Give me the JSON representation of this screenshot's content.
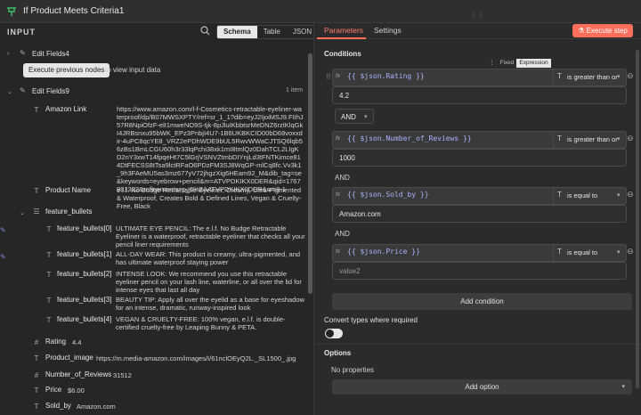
{
  "window": {
    "title": "If Product Meets Criteria1"
  },
  "input_panel": {
    "label": "INPUT",
    "view_tabs": [
      "Schema",
      "Table",
      "JSON"
    ],
    "nodes": [
      {
        "name": "Edit Fields4",
        "action_button": "Execute previous nodes",
        "action_hint": "to view input data"
      },
      {
        "name": "Edit Fields9",
        "count": "1 item"
      }
    ],
    "fields": {
      "amazon_link": {
        "key": "Amazon Link",
        "value": "https://www.amazon.com/l-f-Cosmetics-retractable-eyeliner-waterproof/dp/B07MWSXPTY/ref=sr_1_1?dib=eyJ2IjoiMSJ9.FIIhJ57R8NpiOfzF-elI1mweNO9S-tjk-8pJluIKbbtsrMeDNZ6rzIKlqGkI4JRBsnxu95bWK_EPz3PnbjI4U7-1B6UKBKCID00bD68voxxdir-4uPC8qcYE8_VRZ2ePDhWDE9bUL5RwvWWaCJTSQ6lqb56zBs1BmLCGU60h3r33lqPchi38xk1mI8tmlQz0DahTCL2LIgKD2nY3xwT14fpqeHt7C5lGrjVSNVZtmbDIYnjLd3tFNTKimce814DtFECSS8tTsa9lctRFaO6PDzFM3SJ8WqGP-mlCq8fc.Vv3k1_9h3FAeMU5as3mz677yV72jhgzXig6HEam92_M&dib_tag=se&keywords=eyebrow+pencil&m=ATVPDKIKX0DER&qid=1767981322&refinements=p_6%3AATVPDKIKX0DER&sr=8-1"
      },
      "product_name": {
        "key": "Product Name",
        "value": "e.l.f. No Budge Retractable Eyeliner, Creamy, Ultra-Pigmented & Waterproof, Creates Bold & Defined Lines, Vegan & Cruelty-Free, Black"
      },
      "feature_bullets": {
        "key": "feature_bullets",
        "items": [
          {
            "key": "feature_bullets[0]",
            "value": "ULTIMATE EYE PENCIL: The e.l.f. No Budge Retractable Eyeliner is a waterproof, retractable eyeliner that checks all your pencil liner requirements"
          },
          {
            "key": "feature_bullets[1]",
            "value": "ALL-DAY WEAR: This product is creamy, ultra-pigmented, and has ultimate waterproof staying power"
          },
          {
            "key": "feature_bullets[2]",
            "value": "INTENSE LOOK: We recommend you use this retractable eyeliner pencil on your lash line, waterline, or all over the lid for intense eyes that last all day"
          },
          {
            "key": "feature_bullets[3]",
            "value": "BEAUTY TIP: Apply all over the eyelid as a base for eyeshadow for an intense, dramatic, runway-inspired look"
          },
          {
            "key": "feature_bullets[4]",
            "value": "VEGAN & CRUELTY-FREE: 100% vegan, e.l.f. is double-certified cruelty-free by Leaping Bunny & PETA."
          }
        ]
      },
      "rating": {
        "key": "Rating",
        "value": "4.4"
      },
      "product_image": {
        "key": "Product_image",
        "value": "https://m.media-amazon.com/images/I/61nclOEyQ2L._SL1500_.jpg"
      },
      "number_of_reviews": {
        "key": "Number_of_Reviews",
        "value": "31512"
      },
      "price": {
        "key": "Price",
        "value": "$6.00"
      },
      "sold_by": {
        "key": "Sold_by",
        "value": "Amazon.com"
      }
    }
  },
  "right_panel": {
    "tabs": [
      "Parameters",
      "Settings"
    ],
    "execute_button": "Execute step",
    "conditions_title": "Conditions",
    "mode_toggle": [
      "Fixed",
      "Expression"
    ],
    "conditions": [
      {
        "left": "{{ $json.Rating }}",
        "operator": "is greater than or",
        "value": "4.2"
      },
      {
        "left": "{{ $json.Number_of_Reviews }}",
        "operator": "is greater than or",
        "value": "1000"
      },
      {
        "left": "{{ $json.Sold_by }}",
        "operator": "is equal to",
        "value": "Amazon.com"
      },
      {
        "left": "{{ $json.Price }}",
        "operator": "is equal to",
        "value_placeholder": "value2"
      }
    ],
    "combinator": "AND",
    "add_condition": "Add condition",
    "convert_types_label": "Convert types where required",
    "options_title": "Options",
    "no_properties": "No properties",
    "add_option": "Add option"
  }
}
